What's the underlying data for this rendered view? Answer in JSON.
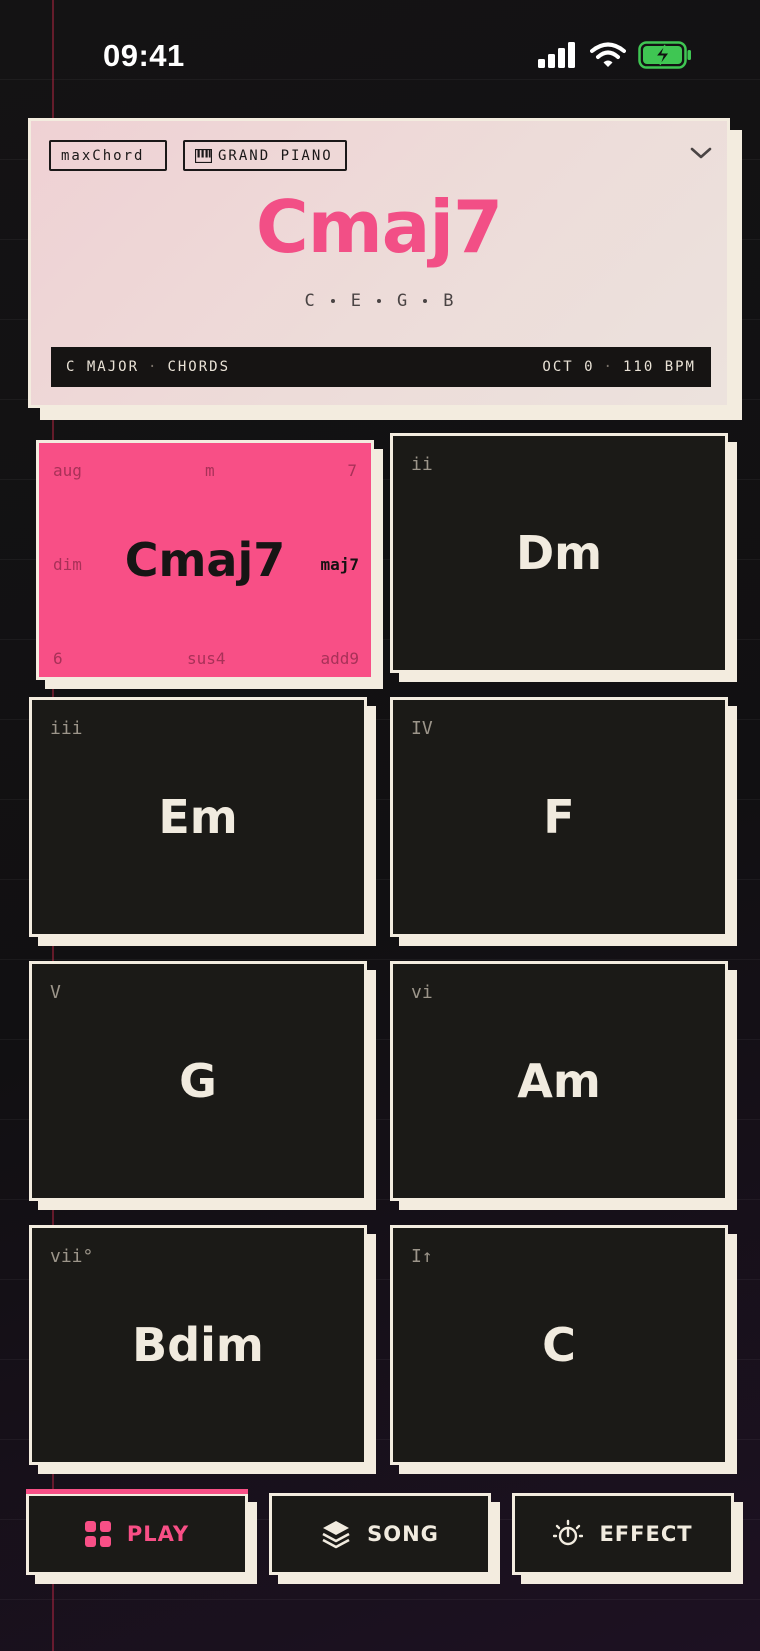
{
  "status": {
    "time": "09:41"
  },
  "header": {
    "app_name": "maxChord",
    "instrument": "GRAND PIANO",
    "current_chord": "Cmaj7",
    "notes": [
      "C",
      "E",
      "G",
      "B"
    ],
    "key_label": "C MAJOR",
    "mode_label": "CHORDS",
    "octave_label": "OCT 0",
    "tempo_label": "110 BPM"
  },
  "pads": [
    {
      "roman": "",
      "name": "Cmaj7",
      "active": true
    },
    {
      "roman": "ii",
      "name": "Dm"
    },
    {
      "roman": "iii",
      "name": "Em"
    },
    {
      "roman": "IV",
      "name": "F"
    },
    {
      "roman": "V",
      "name": "G"
    },
    {
      "roman": "vi",
      "name": "Am"
    },
    {
      "roman": "vii°",
      "name": "Bdim"
    },
    {
      "roman": "I↑",
      "name": "C"
    }
  ],
  "variations": {
    "top_left": "aug",
    "top_center": "m",
    "top_right": "7",
    "mid_left": "dim",
    "mid_right": "maj7",
    "bottom_left": "6",
    "bottom_center": "sus4",
    "bottom_right": "add9",
    "selected": "maj7"
  },
  "nav": {
    "play": "PLAY",
    "song": "SONG",
    "effect": "EFFECT",
    "active": "PLAY"
  },
  "colors": {
    "accent": "#f84f86",
    "pad_bg": "#1b1a17",
    "cream": "#f3ecdf",
    "battery": "#3fc653"
  }
}
